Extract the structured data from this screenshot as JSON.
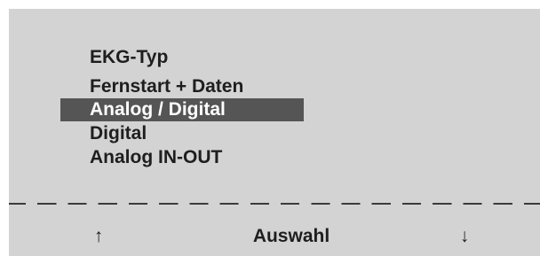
{
  "menu": {
    "title": "EKG-Typ",
    "items": [
      {
        "label": "Fernstart + Daten",
        "selected": false
      },
      {
        "label": "Analog / Digital",
        "selected": true
      },
      {
        "label": "Digital",
        "selected": false
      },
      {
        "label": "Analog IN-OUT",
        "selected": false
      }
    ]
  },
  "softkeys": {
    "up_icon": "↑",
    "select_label": "Auswahl",
    "down_icon": "↓"
  },
  "colors": {
    "screen_background": "#d3d3d3",
    "text": "#1e1e1e",
    "selection_background": "#555555",
    "selection_text": "#ffffff"
  }
}
